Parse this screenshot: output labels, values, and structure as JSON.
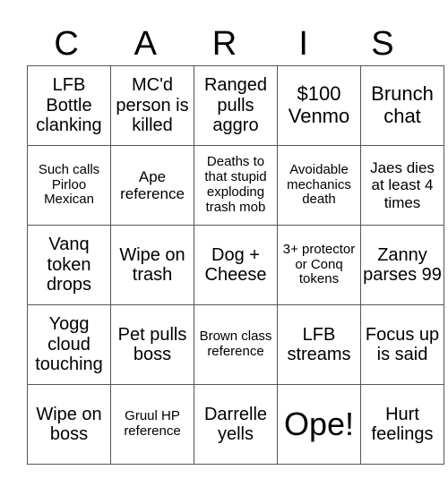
{
  "title_letters": [
    "C",
    "A",
    "R",
    "I",
    "S"
  ],
  "rows": [
    [
      {
        "text": "LFB Bottle clanking",
        "size": "s3"
      },
      {
        "text": "MC'd person is killed",
        "size": "s3"
      },
      {
        "text": "Ranged pulls aggro",
        "size": "s3"
      },
      {
        "text": "$100 Venmo",
        "size": "s4"
      },
      {
        "text": "Brunch chat",
        "size": "s4"
      }
    ],
    [
      {
        "text": "Such calls Pirloo Mexican",
        "size": "s1"
      },
      {
        "text": "Ape reference",
        "size": "s2"
      },
      {
        "text": "Deaths to that stupid exploding trash mob",
        "size": "s1"
      },
      {
        "text": "Avoidable mechanics death",
        "size": "s1"
      },
      {
        "text": "Jaes dies at least 4 times",
        "size": "s2"
      }
    ],
    [
      {
        "text": "Vanq token drops",
        "size": "s3"
      },
      {
        "text": "Wipe on trash",
        "size": "s3"
      },
      {
        "text": "Dog + Cheese",
        "size": "s3"
      },
      {
        "text": "3+ protector or Conq tokens",
        "size": "s1"
      },
      {
        "text": "Zanny parses 99",
        "size": "s3"
      }
    ],
    [
      {
        "text": "Yogg cloud touching",
        "size": "s3"
      },
      {
        "text": "Pet pulls boss",
        "size": "s3"
      },
      {
        "text": "Brown class reference",
        "size": "s1"
      },
      {
        "text": "LFB streams",
        "size": "s3"
      },
      {
        "text": "Focus up is said",
        "size": "s3"
      }
    ],
    [
      {
        "text": "Wipe on boss",
        "size": "s3"
      },
      {
        "text": "Gruul HP reference",
        "size": "s1"
      },
      {
        "text": "Darrelle yells",
        "size": "s3"
      },
      {
        "text": "Ope!",
        "size": "s5"
      },
      {
        "text": "Hurt feelings",
        "size": "s3"
      }
    ]
  ]
}
